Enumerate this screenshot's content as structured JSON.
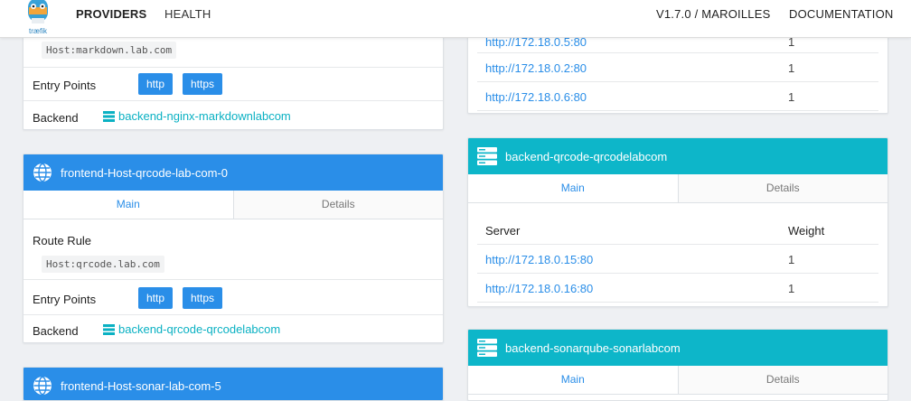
{
  "nav": {
    "logo_text": "træfik",
    "providers": "PROVIDERS",
    "health": "HEALTH",
    "version": "V1.7.0 / MAROILLES",
    "documentation": "DOCUMENTATION"
  },
  "colors": {
    "frontend": "#2a8ee8",
    "backend": "#0db6c9",
    "link": "#0ab1c3"
  },
  "frontend_markdown": {
    "route_value": "Host:markdown.lab.com",
    "entry_points_label": "Entry Points",
    "entry_points": [
      "http",
      "https"
    ],
    "backend_label": "Backend",
    "backend": "backend-nginx-markdownlabcom"
  },
  "frontend_qrcode": {
    "title": "frontend-Host-qrcode-lab-com-0",
    "tabs": [
      "Main",
      "Details"
    ],
    "route_label": "Route Rule",
    "route_value": "Host:qrcode.lab.com",
    "entry_points_label": "Entry Points",
    "entry_points": [
      "http",
      "https"
    ],
    "backend_label": "Backend",
    "backend": "backend-qrcode-qrcodelabcom"
  },
  "frontend_sonar": {
    "title": "frontend-Host-sonar-lab-com-5"
  },
  "backend_nginx": {
    "rows": [
      {
        "server": "http://172.18.0.5:80",
        "weight": "1"
      },
      {
        "server": "http://172.18.0.2:80",
        "weight": "1"
      },
      {
        "server": "http://172.18.0.6:80",
        "weight": "1"
      }
    ]
  },
  "backend_qrcode": {
    "title": "backend-qrcode-qrcodelabcom",
    "tabs": [
      "Main",
      "Details"
    ],
    "header_server": "Server",
    "header_weight": "Weight",
    "rows": [
      {
        "server": "http://172.18.0.15:80",
        "weight": "1"
      },
      {
        "server": "http://172.18.0.16:80",
        "weight": "1"
      }
    ]
  },
  "backend_sonarqube": {
    "title": "backend-sonarqube-sonarlabcom",
    "tabs": [
      "Main",
      "Details"
    ]
  }
}
